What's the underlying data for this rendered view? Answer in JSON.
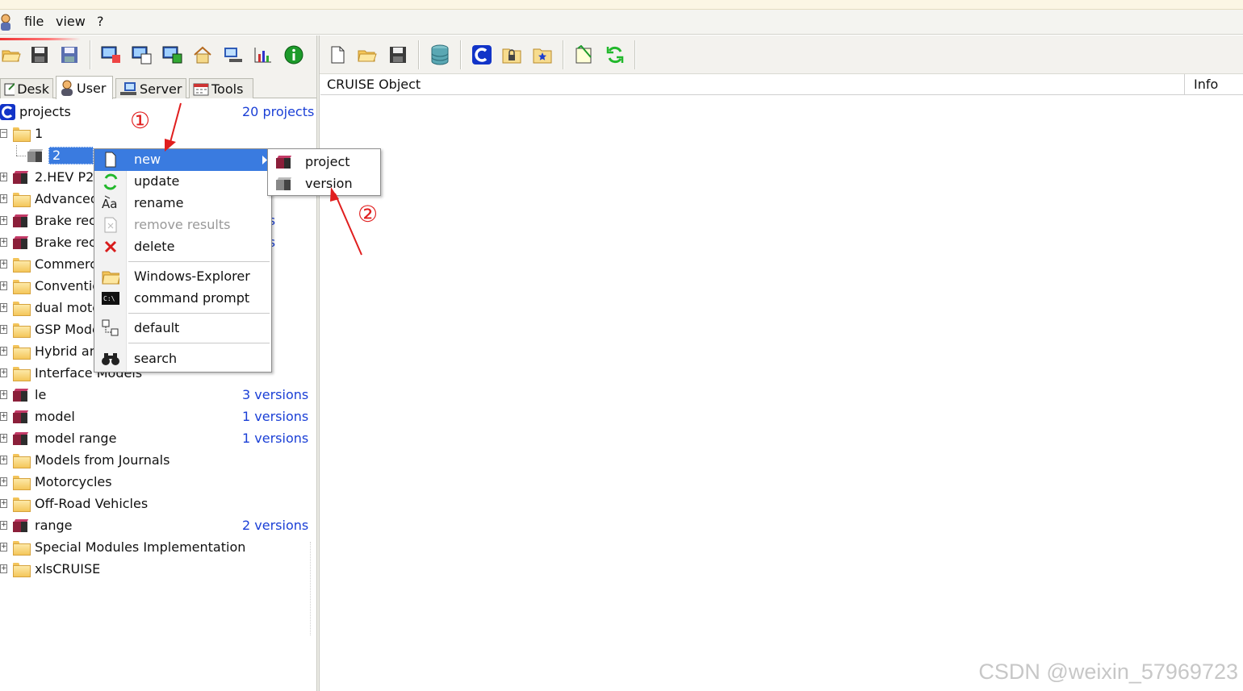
{
  "menubar": {
    "items": [
      "file",
      "view",
      "?"
    ]
  },
  "tabs": [
    {
      "label": "Desk",
      "icon": "desk-icon"
    },
    {
      "label": "User",
      "icon": "user-icon"
    },
    {
      "label": "Server",
      "icon": "server-icon"
    },
    {
      "label": "Tools",
      "icon": "tools-icon"
    }
  ],
  "tree": {
    "root_label": "projects",
    "root_count": "20 projects",
    "node_1": "1",
    "node_2": "2",
    "rows": [
      {
        "label": "2.HEV P2",
        "icon": "project",
        "count": ""
      },
      {
        "label": "Advanced",
        "icon": "folder",
        "count": ""
      },
      {
        "label": "Brake rec",
        "icon": "project",
        "count": "sions"
      },
      {
        "label": "Brake rec",
        "icon": "project",
        "count": "sions"
      },
      {
        "label": "Commerci",
        "icon": "folder",
        "count": ""
      },
      {
        "label": "Conventio",
        "icon": "folder",
        "count": ""
      },
      {
        "label": "dual moto",
        "icon": "folder",
        "count": ""
      },
      {
        "label": "GSP Mode",
        "icon": "folder",
        "count": ""
      },
      {
        "label": "Hybrid an",
        "icon": "folder",
        "count": ""
      },
      {
        "label": "Interface Models",
        "icon": "folder",
        "count": ""
      },
      {
        "label": "le",
        "icon": "project",
        "count": "3 versions"
      },
      {
        "label": "model",
        "icon": "project",
        "count": "1 versions"
      },
      {
        "label": "model range",
        "icon": "project",
        "count": "1 versions"
      },
      {
        "label": "Models from Journals",
        "icon": "folder",
        "count": ""
      },
      {
        "label": "Motorcycles",
        "icon": "folder",
        "count": ""
      },
      {
        "label": "Off-Road Vehicles",
        "icon": "folder",
        "count": ""
      },
      {
        "label": "range",
        "icon": "project",
        "count": "2 versions"
      },
      {
        "label": "Special Modules Implementation",
        "icon": "folder",
        "count": ""
      },
      {
        "label": "xlsCRUISE",
        "icon": "folder",
        "count": ""
      }
    ]
  },
  "context_menu": {
    "new": "new",
    "update": "update",
    "rename": "rename",
    "remove_results": "remove results",
    "delete": "delete",
    "windows_explorer": "Windows-Explorer",
    "command_prompt": "command prompt",
    "default": "default",
    "search": "search"
  },
  "submenu": {
    "project": "project",
    "version": "version"
  },
  "right_pane": {
    "col_object": "CRUISE Object",
    "col_info": "Info"
  },
  "annotations": {
    "one": "①",
    "two": "②"
  },
  "watermark": "CSDN @weixin_57969723",
  "colors": {
    "highlight": "#3a7be0",
    "count_text": "#1a3fd6",
    "annotation": "#e01e1e"
  }
}
